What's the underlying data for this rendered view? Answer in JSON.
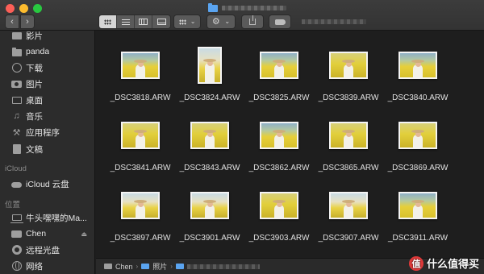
{
  "toolbar": {
    "back_glyph": "‹",
    "forward_glyph": "›",
    "action_glyph": "⚙",
    "chevron_glyph": "⌄"
  },
  "sidebar": {
    "favorites": [
      {
        "label": "影片",
        "icon": "film-icon"
      },
      {
        "label": "panda",
        "icon": "folder-icon"
      },
      {
        "label": "下载",
        "icon": "download-icon"
      },
      {
        "label": "图片",
        "icon": "camera-icon"
      },
      {
        "label": "桌面",
        "icon": "desktop-icon"
      },
      {
        "label": "音乐",
        "icon": "music-icon"
      },
      {
        "label": "应用程序",
        "icon": "apps-icon"
      },
      {
        "label": "文稿",
        "icon": "document-icon"
      }
    ],
    "icloud_header": "iCloud",
    "icloud_items": [
      {
        "label": "iCloud 云盘",
        "icon": "cloud-icon"
      }
    ],
    "locations_header": "位置",
    "locations": [
      {
        "label": "牛头嘿嘿的Ma...",
        "icon": "laptop-icon"
      },
      {
        "label": "Chen",
        "icon": "hdd-icon",
        "eject": "⏏"
      },
      {
        "label": "远程光盘",
        "icon": "disc-icon"
      },
      {
        "label": "网络",
        "icon": "globe-icon"
      }
    ]
  },
  "files": [
    {
      "name": "_DSC3818.ARW",
      "orientation": "land",
      "tone": "a"
    },
    {
      "name": "_DSC3824.ARW",
      "orientation": "port",
      "tone": "c"
    },
    {
      "name": "_DSC3825.ARW",
      "orientation": "land",
      "tone": "a"
    },
    {
      "name": "_DSC3839.ARW",
      "orientation": "land",
      "tone": "b"
    },
    {
      "name": "_DSC3840.ARW",
      "orientation": "land",
      "tone": "a"
    },
    {
      "name": "_DSC3841.ARW",
      "orientation": "land",
      "tone": "b"
    },
    {
      "name": "_DSC3843.ARW",
      "orientation": "land",
      "tone": "b"
    },
    {
      "name": "_DSC3862.ARW",
      "orientation": "land",
      "tone": "a"
    },
    {
      "name": "_DSC3865.ARW",
      "orientation": "land",
      "tone": "b"
    },
    {
      "name": "_DSC3869.ARW",
      "orientation": "land",
      "tone": "b"
    },
    {
      "name": "_DSC3897.ARW",
      "orientation": "land",
      "tone": "c"
    },
    {
      "name": "_DSC3901.ARW",
      "orientation": "land",
      "tone": "c"
    },
    {
      "name": "_DSC3903.ARW",
      "orientation": "land",
      "tone": "b"
    },
    {
      "name": "_DSC3907.ARW",
      "orientation": "land",
      "tone": "c"
    },
    {
      "name": "_DSC3911.ARW",
      "orientation": "land",
      "tone": "a"
    }
  ],
  "pathbar": {
    "items": [
      "Chen",
      "照片"
    ],
    "separator": "›"
  },
  "watermark": {
    "badge": "值",
    "text": "什么值得买"
  }
}
